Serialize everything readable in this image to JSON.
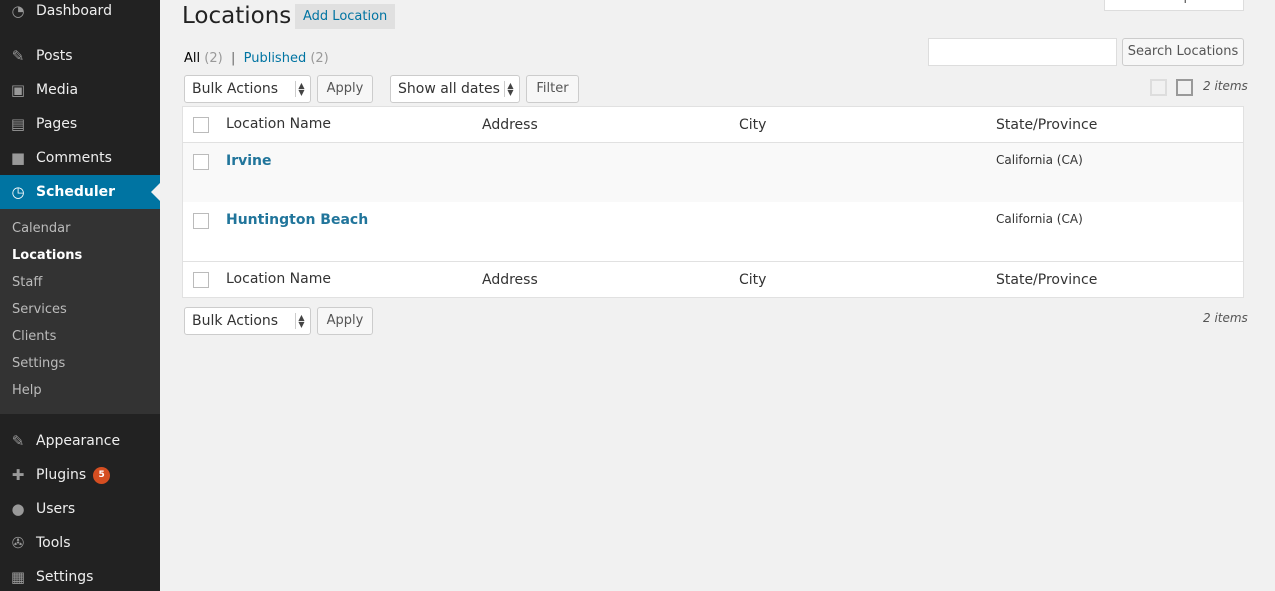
{
  "sidebar": {
    "items": [
      {
        "label": "Dashboard",
        "icon": "dashboard-icon",
        "glyph": "◔"
      },
      {
        "label": "Posts",
        "icon": "pin-icon",
        "glyph": "✎"
      },
      {
        "label": "Media",
        "icon": "media-icon",
        "glyph": "▣"
      },
      {
        "label": "Pages",
        "icon": "pages-icon",
        "glyph": "▤"
      },
      {
        "label": "Comments",
        "icon": "comment-icon",
        "glyph": "■"
      },
      {
        "label": "Scheduler",
        "icon": "calendar-clock-icon",
        "glyph": "◷"
      },
      {
        "label": "Appearance",
        "icon": "brush-icon",
        "glyph": "✎"
      },
      {
        "label": "Plugins",
        "icon": "plug-icon",
        "glyph": "✚",
        "badge": "5"
      },
      {
        "label": "Users",
        "icon": "user-icon",
        "glyph": "●"
      },
      {
        "label": "Tools",
        "icon": "wrench-icon",
        "glyph": "✇"
      },
      {
        "label": "Settings",
        "icon": "sliders-icon",
        "glyph": "▦"
      }
    ],
    "submenu": [
      "Calendar",
      "Locations",
      "Staff",
      "Services",
      "Clients",
      "Settings",
      "Help"
    ]
  },
  "header": {
    "screen_options": "Screen Options",
    "title": "Locations",
    "add_button": "Add Location"
  },
  "filters": {
    "all_label": "All",
    "all_count": "(2)",
    "separator": "|",
    "published_label": "Published",
    "published_count": "(2)"
  },
  "search": {
    "value": "",
    "button": "Search Locations"
  },
  "toolbar": {
    "bulk_actions": "Bulk Actions",
    "apply": "Apply",
    "dates": "Show all dates",
    "filter": "Filter",
    "items": "2 items"
  },
  "table": {
    "columns": [
      "Location Name",
      "Address",
      "City",
      "State/Province"
    ],
    "rows": [
      {
        "name": "Irvine",
        "address": "",
        "city": "",
        "state": "California (CA)"
      },
      {
        "name": "Huntington Beach",
        "address": "",
        "city": "",
        "state": "California (CA)"
      }
    ]
  },
  "colors": {
    "sidebar_bg": "#222222",
    "active_bg": "#0074a2",
    "link": "#21759b",
    "badge": "#d54e21"
  }
}
